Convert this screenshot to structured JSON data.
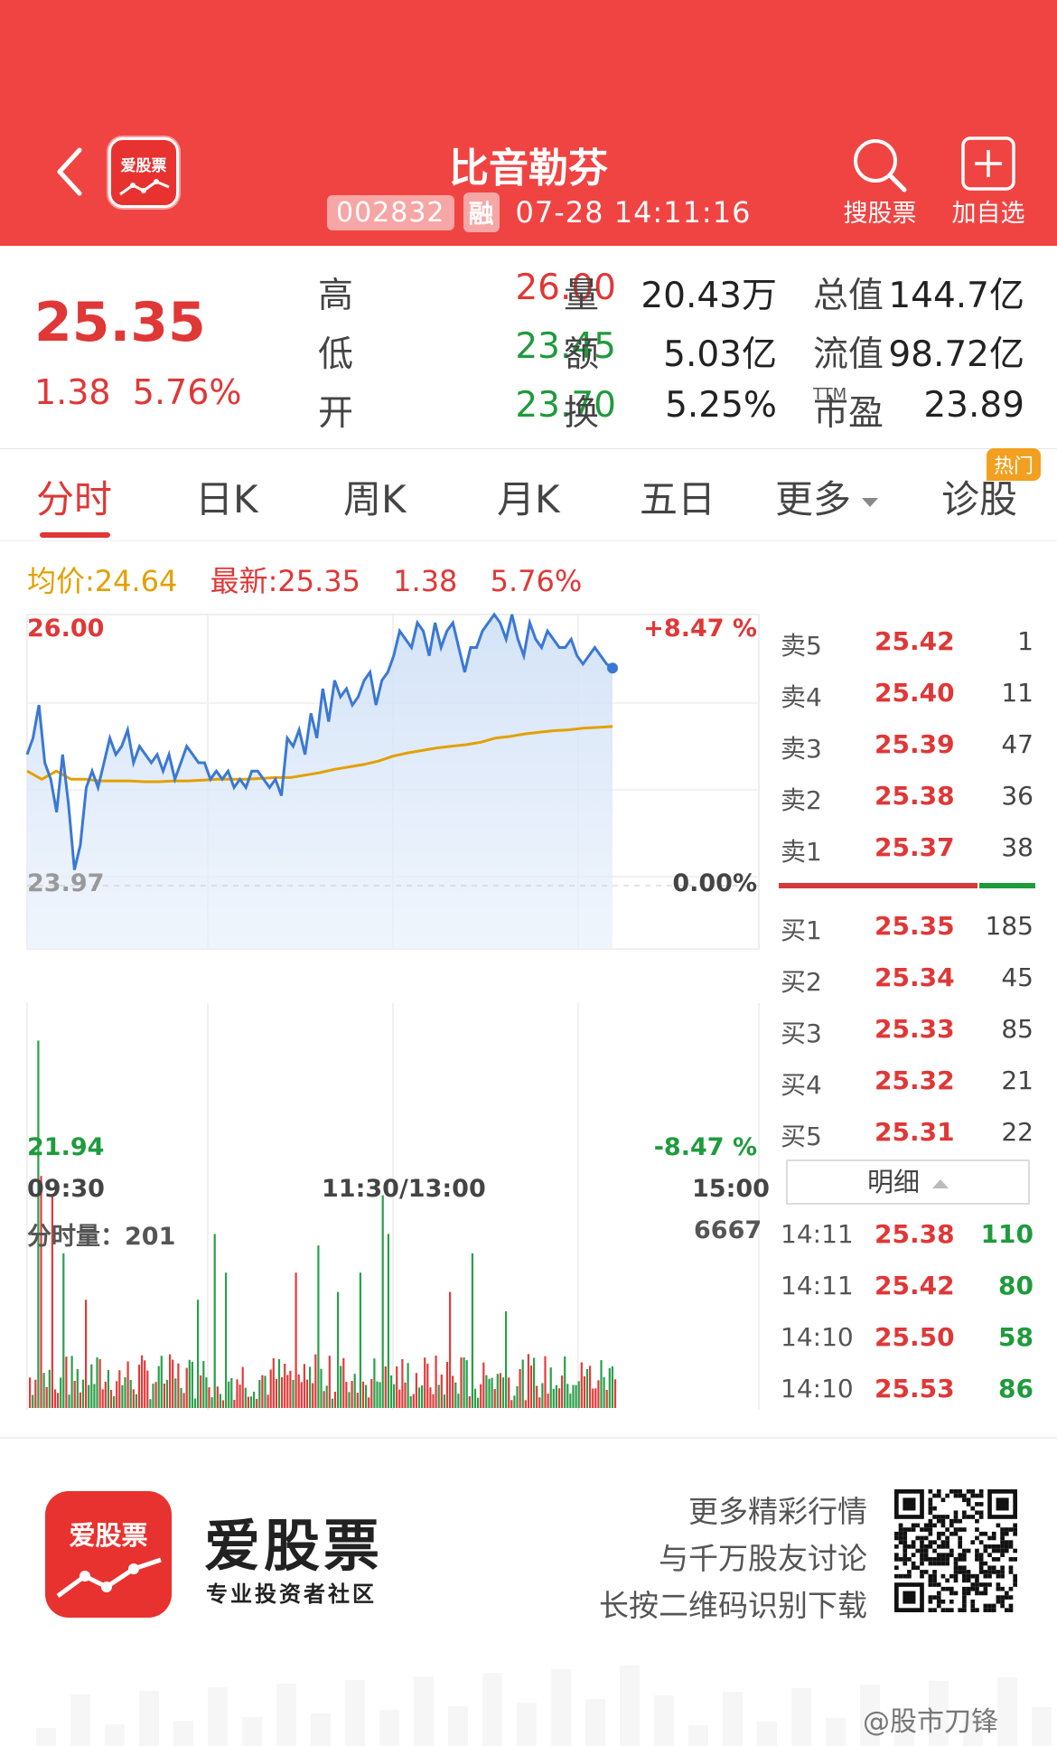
{
  "header": {
    "title": "比音勒芬",
    "code": "002832",
    "margin_tag": "融",
    "timestamp": "07-28 14:11:16",
    "logo_text": "爱股票",
    "search_label": "搜股票",
    "add_label": "加自选"
  },
  "quote": {
    "price": "25.35",
    "change": "1.38",
    "change_pct": "5.76%",
    "rows": [
      {
        "l1": "高",
        "v1": "26.00",
        "l2": "量",
        "v2": "20.43万",
        "l3": "总值",
        "v3": "144.7亿"
      },
      {
        "l1": "低",
        "v1": "23.45",
        "l2": "额",
        "v2": "5.03亿",
        "l3": "流值",
        "v3": "98.72亿"
      },
      {
        "l1": "开",
        "v1": "23.70",
        "l2": "换",
        "v2": "5.25%",
        "l3": "市盈",
        "v3": "23.89"
      }
    ],
    "ttm": "TTM"
  },
  "tabs": [
    "分时",
    "日K",
    "周K",
    "月K",
    "五日",
    "更多",
    "诊股"
  ],
  "hot_badge": "热门",
  "info": {
    "avg_label": "均价:24.64",
    "latest_label": "最新:25.35",
    "change": "1.38",
    "pct": "5.76%"
  },
  "chart_axis": {
    "high": "26.00",
    "low": "21.94",
    "base": "23.97",
    "pct_up": "+8.47 %",
    "pct_zero": "0.00%",
    "pct_down": "-8.47 %",
    "t_start": "09:30",
    "t_mid": "11:30/13:00",
    "t_end": "15:00",
    "vol_label": "分时量：201",
    "vol_max": "6667"
  },
  "chart_data": {
    "type": "line",
    "title": "",
    "x_range": [
      "09:30",
      "15:00"
    ],
    "ylim": [
      21.94,
      26.0
    ],
    "series": [
      {
        "values": [
          24.3,
          24.5,
          24.9,
          24.2,
          24.0,
          23.6,
          24.3,
          23.7,
          22.9,
          23.2,
          23.9,
          24.1,
          23.9,
          24.2,
          24.5,
          24.3,
          24.4,
          24.6,
          24.2,
          24.4,
          24.3,
          24.2,
          24.3,
          24.1,
          24.3,
          24.0,
          24.2,
          24.4,
          24.3,
          24.2,
          24.2,
          24.0,
          24.1,
          24.0,
          24.1,
          23.9,
          24.0,
          23.9,
          24.1,
          24.1,
          24.0,
          23.9,
          24.0,
          23.8,
          24.5,
          24.4,
          24.6,
          24.3,
          24.8,
          24.5,
          25.1,
          24.7,
          25.2,
          25.0,
          25.1,
          24.9,
          25.0,
          25.2,
          25.3,
          24.9,
          25.2,
          25.3,
          25.5,
          25.8,
          25.7,
          25.6,
          25.9,
          25.8,
          25.5,
          25.9,
          25.6,
          25.8,
          25.9,
          25.6,
          25.3,
          25.6,
          25.6,
          25.8,
          25.9,
          26.0,
          25.9,
          25.7,
          26.0,
          25.7,
          25.5,
          25.9,
          25.7,
          25.6,
          25.8,
          25.7,
          25.6,
          25.6,
          25.7,
          25.5,
          25.4,
          25.5,
          25.6,
          25.5,
          25.4,
          25.35
        ]
      },
      {
        "values": [
          24.1,
          24.0,
          24.1,
          24.0,
          24.0,
          23.98,
          23.98,
          23.98,
          23.97,
          23.97,
          23.98,
          23.98,
          23.99,
          24.0,
          24.0,
          24.0,
          24.01,
          24.02,
          24.02,
          24.05,
          24.08,
          24.12,
          24.15,
          24.18,
          24.22,
          24.28,
          24.32,
          24.35,
          24.38,
          24.4,
          24.42,
          24.45,
          24.5,
          24.52,
          24.55,
          24.57,
          24.59,
          24.6,
          24.62,
          24.63,
          24.64
        ]
      }
    ]
  },
  "order_book": {
    "asks": [
      {
        "label": "卖5",
        "price": "25.42",
        "vol": "1"
      },
      {
        "label": "卖4",
        "price": "25.40",
        "vol": "11"
      },
      {
        "label": "卖3",
        "price": "25.39",
        "vol": "47"
      },
      {
        "label": "卖2",
        "price": "25.38",
        "vol": "36"
      },
      {
        "label": "卖1",
        "price": "25.37",
        "vol": "38"
      }
    ],
    "bids": [
      {
        "label": "买1",
        "price": "25.35",
        "vol": "185"
      },
      {
        "label": "买2",
        "price": "25.34",
        "vol": "45"
      },
      {
        "label": "买3",
        "price": "25.33",
        "vol": "85"
      },
      {
        "label": "买4",
        "price": "25.32",
        "vol": "21"
      },
      {
        "label": "买5",
        "price": "25.31",
        "vol": "22"
      }
    ],
    "detail_label": "明细",
    "ticks": [
      {
        "time": "14:11",
        "price": "25.38",
        "vol": "110"
      },
      {
        "time": "14:11",
        "price": "25.42",
        "vol": "80"
      },
      {
        "time": "14:10",
        "price": "25.50",
        "vol": "58"
      },
      {
        "time": "14:10",
        "price": "25.53",
        "vol": "86"
      }
    ]
  },
  "footer": {
    "logo_text": "爱股票",
    "brand": "爱股票",
    "brand_sub": "专业投资者社区",
    "promo": [
      "更多精彩行情",
      "与千万股友讨论",
      "长按二维码识别下载"
    ],
    "watermark": "@股市刀锋"
  },
  "colors": {
    "header_red": "#f04443",
    "up_red": "#e03737",
    "down_green": "#1f9b3d",
    "avg_line": "#e3a000",
    "price_line": "#3a78d4"
  }
}
